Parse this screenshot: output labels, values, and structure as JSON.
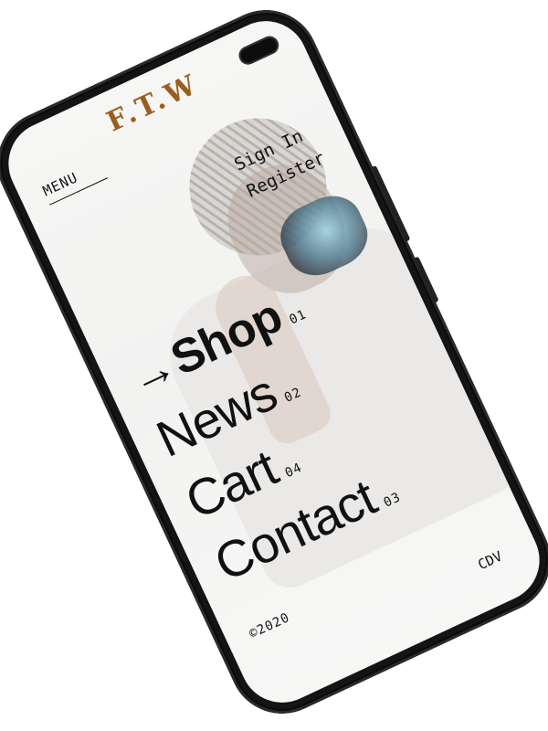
{
  "brand": {
    "logo_text": "F.T.W",
    "logo_color": "#9a5e1e"
  },
  "header": {
    "menu_label": "MENU"
  },
  "auth": {
    "sign_in": "Sign In",
    "register": "Register"
  },
  "nav": {
    "active_arrow": "→",
    "items": [
      {
        "label": "Shop",
        "number": "01",
        "active": true
      },
      {
        "label": "News",
        "number": "02",
        "active": false
      },
      {
        "label": "Cart",
        "number": "04",
        "active": false
      },
      {
        "label": "Contact",
        "number": "03",
        "active": false
      }
    ]
  },
  "footer": {
    "copyright": "©2020",
    "credit": "CDV"
  },
  "colors": {
    "phone_body": "#141414",
    "screen_bg": "#f4f4f3",
    "text": "#111111"
  },
  "icons": {
    "nav_active": "arrow-right-icon",
    "camera": "front-camera-icon"
  }
}
